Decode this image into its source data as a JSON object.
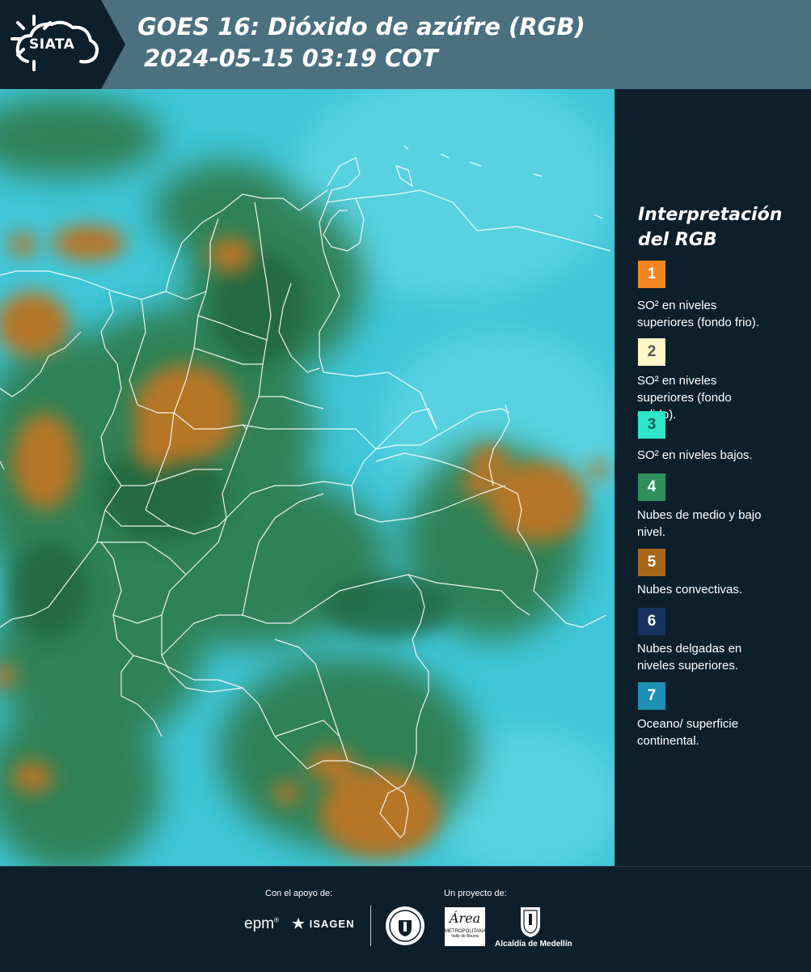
{
  "header": {
    "logo_text": "SIATA",
    "title_line1": "GOES 16: Dióxido de azúfre (RGB)",
    "title_line2": "2024-05-15 03:19 COT"
  },
  "legend": {
    "title_line1": "Interpretación",
    "title_line2": "del RGB",
    "items": [
      {
        "number": "1",
        "color": "#f4851f",
        "text_color": "#ffffff",
        "lines": [
          "SO² en niveles",
          "superiores (fondo frio)."
        ]
      },
      {
        "number": "2",
        "color": "#fdf6c5",
        "text_color": "#555555",
        "lines": [
          "SO² en niveles",
          "superiores (fondo",
          "calido)."
        ]
      },
      {
        "number": "3",
        "color": "#2de5c8",
        "text_color": "#1f5d55",
        "lines": [
          "SO² en niveles bajos."
        ]
      },
      {
        "number": "4",
        "color": "#2f8f5d",
        "text_color": "#ffffff",
        "lines": [
          "Nubes de medio y bajo",
          "nivel."
        ]
      },
      {
        "number": "5",
        "color": "#a8671b",
        "text_color": "#ffffff",
        "lines": [
          "Nubes convectivas."
        ]
      },
      {
        "number": "6",
        "color": "#15335e",
        "text_color": "#ffffff",
        "lines": [
          "Nubes delgadas en",
          "niveles superiores."
        ]
      },
      {
        "number": "7",
        "color": "#1c8fb5",
        "text_color": "#ffffff",
        "lines": [
          "Oceano/ superficie",
          "continental."
        ]
      }
    ]
  },
  "footer": {
    "support_label": "Con el apoyo de:",
    "project_label": "Un proyecto de:",
    "epm": "epm",
    "isagen": "ISAGEN",
    "area_word": "Área",
    "area_sub1": "METROPOLITANA",
    "area_sub2": "Valle de Aburrá",
    "alcaldia": "Alcaldía de Medellín"
  },
  "colors": {
    "background": "#0e1f2c",
    "header_band": "#4b7080",
    "map_sky": "#3fc6d8",
    "cloud_green": "#2f7a4a",
    "convective": "#a8671b"
  }
}
